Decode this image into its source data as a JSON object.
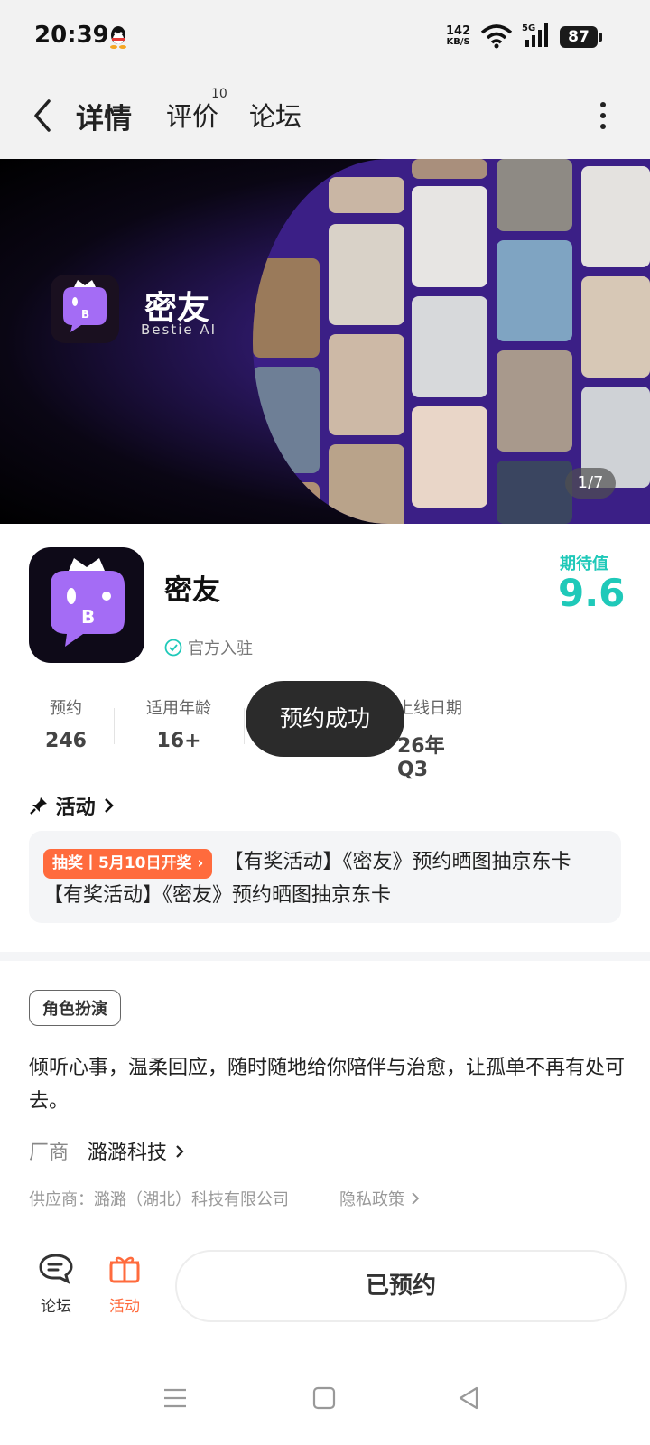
{
  "status_bar": {
    "time": "20:39",
    "net_speed_value": "142",
    "net_speed_unit": "KB/S",
    "signal_label": "5G",
    "battery": "87"
  },
  "header": {
    "tabs": [
      {
        "label": "详情",
        "active": true
      },
      {
        "label": "评价",
        "badge": "10"
      },
      {
        "label": "论坛"
      }
    ]
  },
  "banner": {
    "title": "密友",
    "subtitle": "Bestie AI",
    "counter": "1/7"
  },
  "app": {
    "name": "密友",
    "verified_label": "官方入驻",
    "expectation_label": "期待值",
    "expectation_value": "9.6",
    "accent_color": "#1fc9b9"
  },
  "stats": [
    {
      "label": "预约",
      "value": "246"
    },
    {
      "label": "适用年龄",
      "value": "16+"
    },
    {
      "label": "上线日期",
      "value": "26年Q3"
    }
  ],
  "toast": "预约成功",
  "activity": {
    "title": "活动",
    "badge": "抽奖丨5月10日开奖",
    "text": "【有奖活动】《密友》预约晒图抽京东卡 【有奖活动】《密友》预约晒图抽京东卡"
  },
  "details": {
    "category_tag": "角色扮演",
    "description": "倾听心事，温柔回应，随时随地给你陪伴与治愈，让孤单不再有处可去。",
    "vendor_label": "厂商",
    "vendor_name": "潞潞科技",
    "supplier": "供应商：潞潞（湖北）科技有限公司",
    "privacy": "隐私政策"
  },
  "bottom_bar": {
    "forum_label": "论坛",
    "activity_label": "活动",
    "reserved_label": "已预约",
    "activity_color": "#ff6b3d"
  }
}
